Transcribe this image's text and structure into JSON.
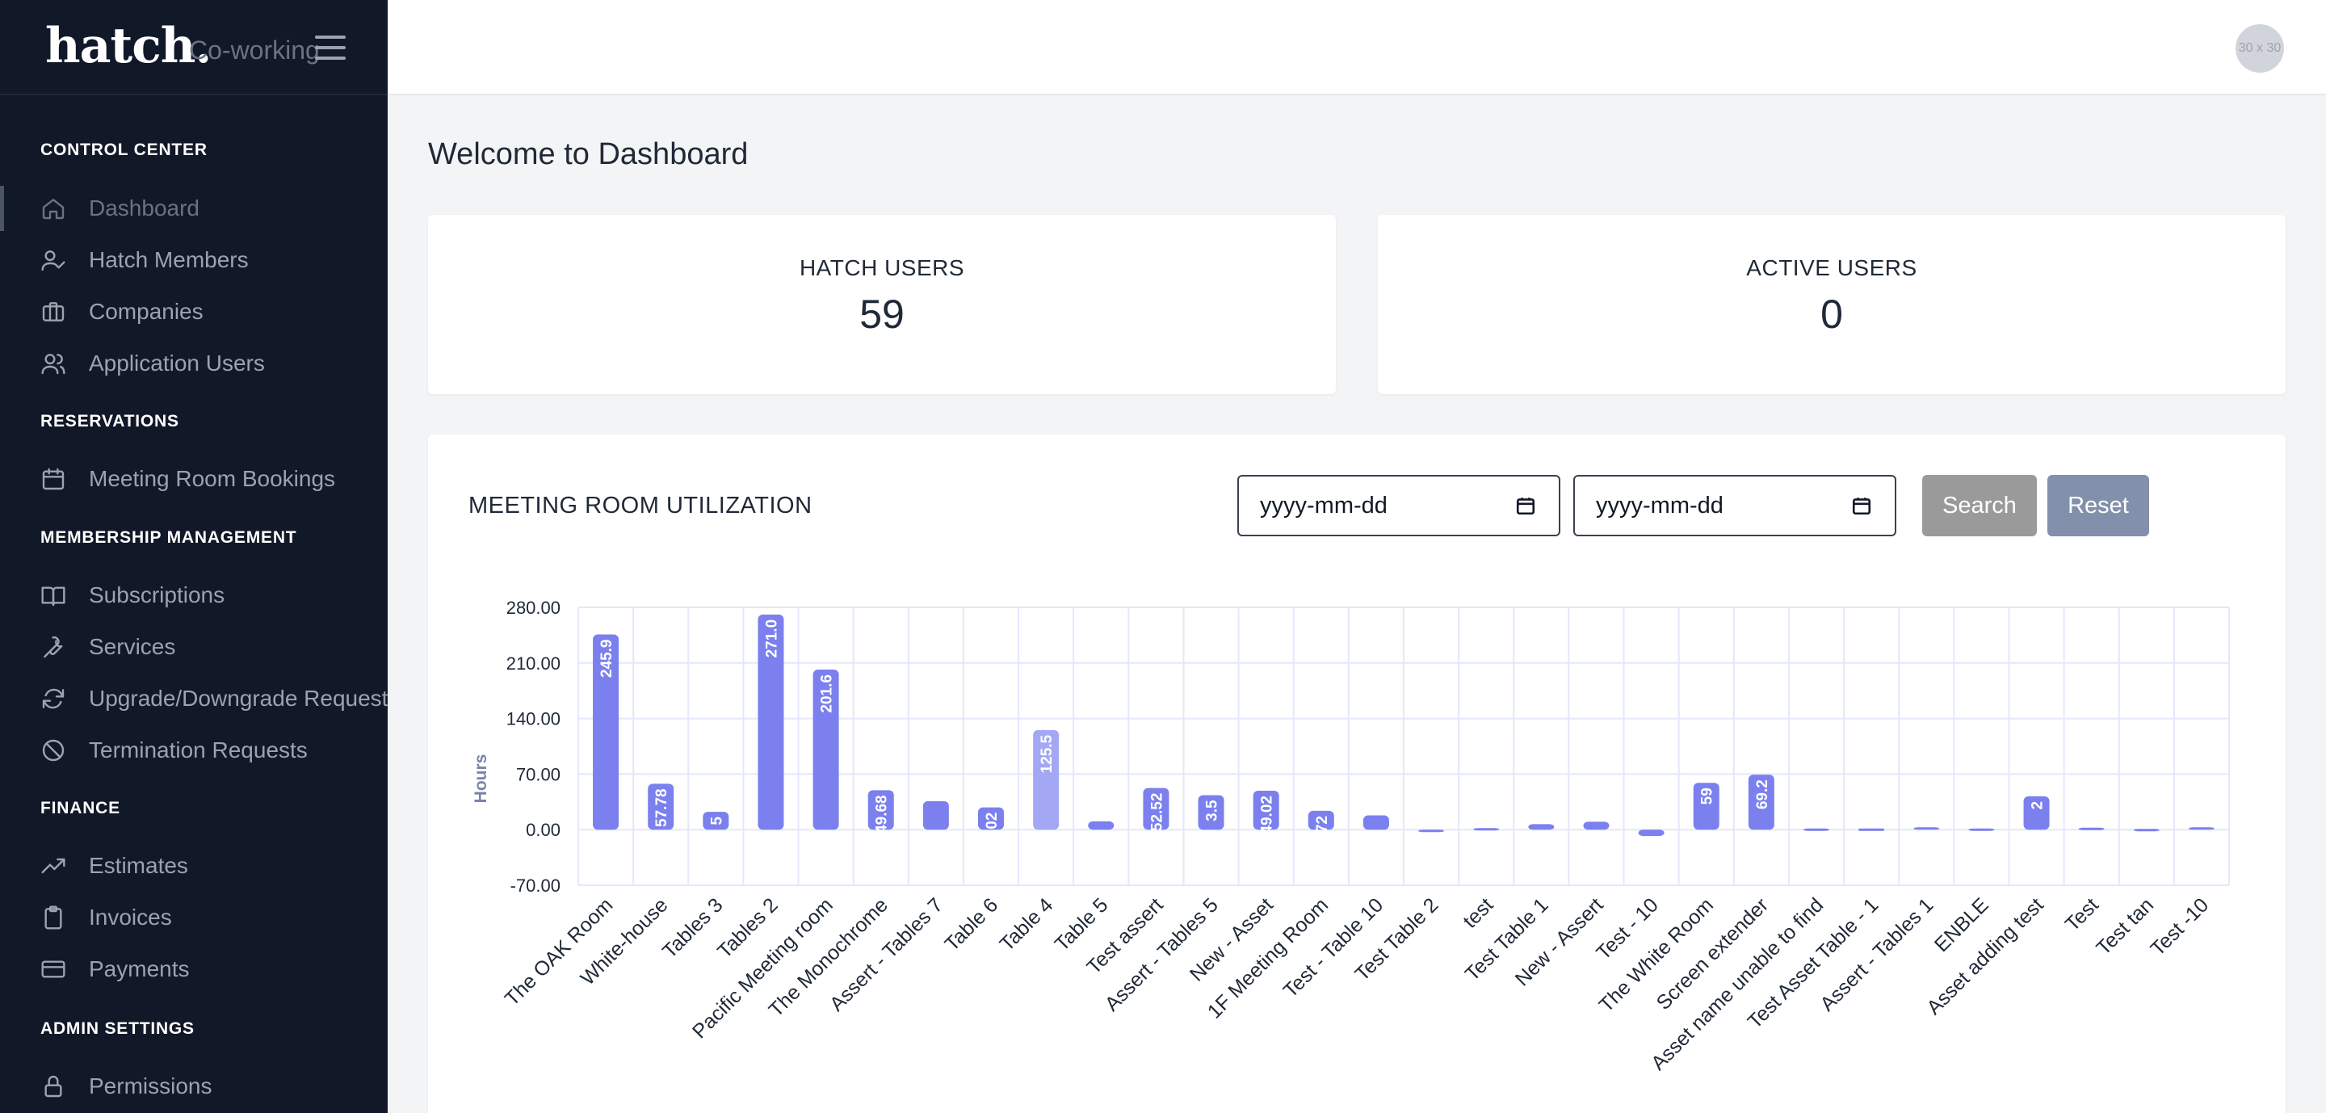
{
  "brand": {
    "logo": "hatch.",
    "sub": "Co-working"
  },
  "avatar": {
    "text": "30 x 30"
  },
  "sidebar": {
    "sections": [
      {
        "title": "CONTROL CENTER",
        "items": [
          {
            "label": "Dashboard",
            "icon": "home-icon",
            "active": true
          },
          {
            "label": "Hatch Members",
            "icon": "user-check-icon"
          },
          {
            "label": "Companies",
            "icon": "briefcase-icon"
          },
          {
            "label": "Application Users",
            "icon": "users-icon"
          }
        ]
      },
      {
        "title": "RESERVATIONS",
        "items": [
          {
            "label": "Meeting Room Bookings",
            "icon": "calendar-icon"
          }
        ]
      },
      {
        "title": "MEMBERSHIP MANAGEMENT",
        "items": [
          {
            "label": "Subscriptions",
            "icon": "book-open-icon"
          },
          {
            "label": "Services",
            "icon": "wrench-icon"
          },
          {
            "label": "Upgrade/Downgrade Request",
            "icon": "refresh-icon"
          },
          {
            "label": "Termination Requests",
            "icon": "ban-icon"
          }
        ]
      },
      {
        "title": "FINANCE",
        "items": [
          {
            "label": "Estimates",
            "icon": "trending-up-icon"
          },
          {
            "label": "Invoices",
            "icon": "clipboard-icon"
          },
          {
            "label": "Payments",
            "icon": "credit-card-icon"
          }
        ]
      },
      {
        "title": "ADMIN SETTINGS",
        "items": [
          {
            "label": "Permissions",
            "icon": "lock-icon"
          }
        ]
      }
    ]
  },
  "main": {
    "title": "Welcome to Dashboard",
    "stats": [
      {
        "label": "HATCH USERS",
        "value": "59"
      },
      {
        "label": "ACTIVE USERS",
        "value": "0"
      }
    ],
    "utilization": {
      "title": "MEETING ROOM UTILIZATION",
      "date_from_placeholder": "yyyy-mm-dd",
      "date_to_placeholder": "yyyy-mm-dd",
      "search_label": "Search",
      "reset_label": "Reset"
    }
  },
  "chart_data": {
    "type": "bar",
    "ylabel": "Hours",
    "xlabel": "",
    "ylim": [
      -70,
      280
    ],
    "yticks": [
      "280.00",
      "210.00",
      "140.00",
      "70.00",
      "0.00",
      "-70.00"
    ],
    "grid": true,
    "bar_color": "#7b80ee",
    "highlight_color": "#a3a7f4",
    "highlight_index": 8,
    "categories": [
      "The OAK Room",
      "White-house",
      "Tables 3",
      "Tables 2",
      "Pacific Meeting room",
      "The Monochrome",
      "Assert - Tables 7",
      "Table 6",
      "Table 4",
      "Table 5",
      "Test assert",
      "Assert - Tables 5",
      "New - Asset",
      "1F Meeting Room",
      "Test - Table 10",
      "Test Table 2",
      "test",
      "Test Table 1",
      "New - Assert",
      "Test - 10",
      "The White Room",
      "Screen extender",
      "Asset name unable to find",
      "Test Asset Table - 1",
      "Assert - Tables 1",
      "ENBLE",
      "Asset adding test",
      "Test",
      "Test tan",
      "Test -10"
    ],
    "values": [
      245.9,
      57.78,
      22.5,
      271.0,
      201.6,
      49.68,
      36,
      28.02,
      125.5,
      10.5,
      52.52,
      43.5,
      49.02,
      23.72,
      18,
      -3,
      2,
      7,
      10,
      -8,
      59,
      69.2,
      1.5,
      0,
      3,
      1.5,
      42,
      2.5,
      1,
      3
    ],
    "data_labels": [
      "245.9",
      "57.78",
      "5",
      "271.0",
      "201.6",
      "49.68",
      "",
      "02",
      "125.5",
      "",
      "52.52",
      "3.5",
      "49.02",
      "72",
      "",
      "",
      "",
      "",
      "",
      "",
      "59",
      "69.2",
      "",
      "",
      "",
      "",
      "2",
      "",
      "",
      ""
    ]
  }
}
